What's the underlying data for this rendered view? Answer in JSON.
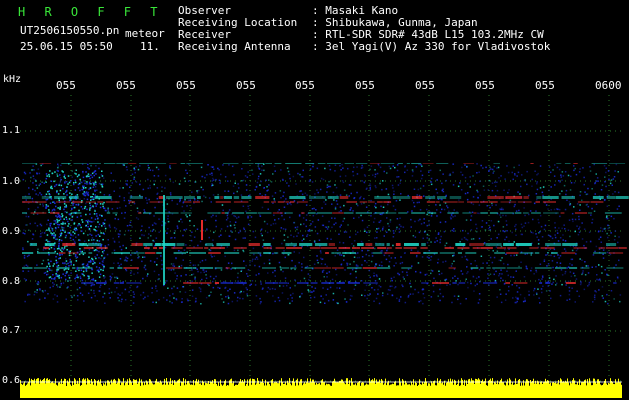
{
  "header": {
    "brand": "H R O F F T",
    "filename": "UT2506150550.pn",
    "meteor_label": "meteor",
    "datetime": "25.06.15 05:50",
    "count": "11."
  },
  "info": [
    {
      "label": "Observer",
      "value": ": Masaki Kano"
    },
    {
      "label": "Receiving Location",
      "value": ": Shibukawa, Gunma, Japan"
    },
    {
      "label": "Receiver",
      "value": ": RTL-SDR SDR# 43dB L15 103.2MHz CW"
    },
    {
      "label": "Receiving Antenna",
      "value": ": 3el Yagi(V) Az 330 for Vladivostok"
    }
  ],
  "axis": {
    "unit": "kHz",
    "time_ticks": [
      "055",
      "055",
      "055",
      "055",
      "055",
      "055",
      "055",
      "055",
      "055",
      "0600"
    ],
    "freq_ticks": [
      "1.1",
      "1.0",
      "0.9",
      "0.8",
      "0.7",
      "0.6"
    ]
  },
  "colors": {
    "brand": "#39e639",
    "grid": "#2a7a2a",
    "level_bar": "#ffff00",
    "signal_low": "#1a2bd6",
    "signal_mid": "#20d8c8",
    "signal_high": "#ff3030"
  }
}
